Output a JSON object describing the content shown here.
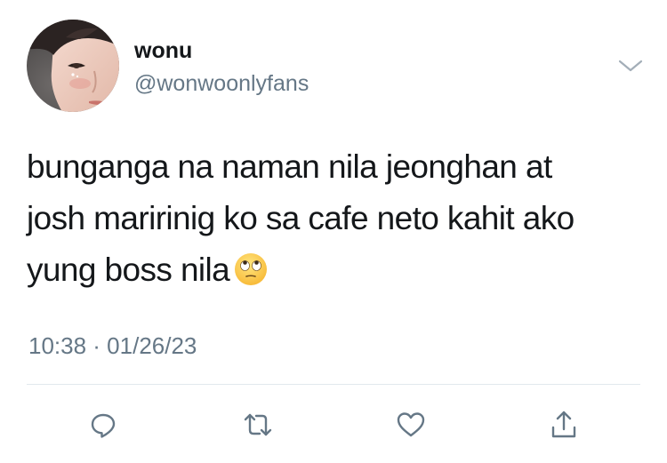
{
  "user": {
    "display_name": "wonu",
    "handle": "@wonwoonlyfans"
  },
  "tweet": {
    "text_lines": [
      "bunganga na naman nila jeonghan at",
      "josh maririnig ko sa cafe neto kahit ako",
      "yung boss nila"
    ],
    "emoji": "face-with-rolling-eyes",
    "timestamp": "10:38 · 01/26/23"
  },
  "actions": [
    {
      "icon": "reply-icon"
    },
    {
      "icon": "retweet-icon"
    },
    {
      "icon": "like-icon"
    },
    {
      "icon": "share-icon"
    }
  ],
  "colors": {
    "text": "#14171a",
    "secondary": "#657786",
    "divider": "#e1e8ed"
  }
}
